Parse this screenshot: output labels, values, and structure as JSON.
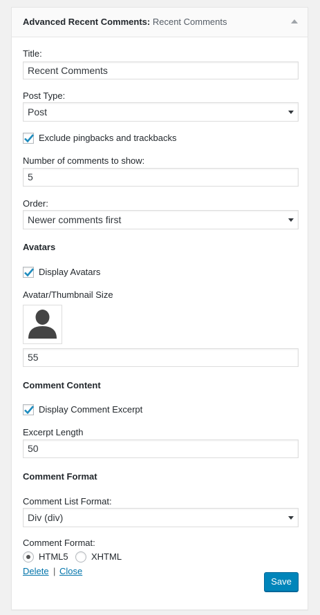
{
  "widget": {
    "title": "Advanced Recent Comments:",
    "subtitle": "Recent Comments"
  },
  "fields": {
    "title_label": "Title:",
    "title_value": "Recent Comments",
    "post_type_label": "Post Type:",
    "post_type_value": "Post",
    "exclude_pingbacks_label": "Exclude pingbacks and trackbacks",
    "exclude_pingbacks_checked": true,
    "num_comments_label": "Number of comments to show:",
    "num_comments_value": "5",
    "order_label": "Order:",
    "order_value": "Newer comments first"
  },
  "avatars": {
    "heading": "Avatars",
    "display_label": "Display Avatars",
    "display_checked": true,
    "size_label": "Avatar/Thumbnail Size",
    "size_value": "55"
  },
  "comment_content": {
    "heading": "Comment Content",
    "excerpt_label": "Display Comment Excerpt",
    "excerpt_checked": true,
    "length_label": "Excerpt Length",
    "length_value": "50"
  },
  "comment_format": {
    "heading": "Comment Format",
    "list_format_label": "Comment List Format:",
    "list_format_value": "Div (div)",
    "format_label": "Comment Format:",
    "options": [
      "HTML5",
      "XHTML"
    ],
    "selected": "HTML5"
  },
  "actions": {
    "delete_label": "Delete",
    "separator": "|",
    "close_label": "Close",
    "save_label": "Save"
  },
  "colors": {
    "primary_button": "#0085ba",
    "link": "#0073aa",
    "checkmark": "#1e8cbe"
  }
}
